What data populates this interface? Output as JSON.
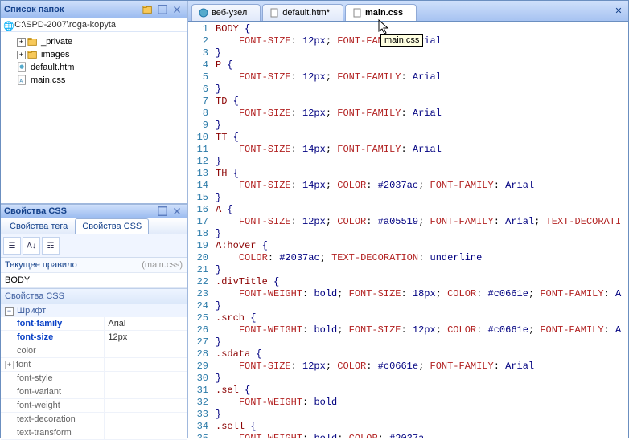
{
  "folder_panel": {
    "title": "Список папок",
    "address": "C:\\SPD-2007\\roga-kopyta",
    "items": [
      {
        "label": "_private",
        "type": "folder",
        "expand": "plus"
      },
      {
        "label": "images",
        "type": "folder",
        "expand": "plus"
      },
      {
        "label": "default.htm",
        "type": "file-htm"
      },
      {
        "label": "main.css",
        "type": "file-css"
      }
    ]
  },
  "css_panel": {
    "title": "Свойства CSS",
    "tabs": {
      "tag": "Свойства тега",
      "css": "Свойства CSS"
    },
    "rule_label": "Текущее правило",
    "rule_file": "(main.css)",
    "selector": "BODY",
    "section": "Свойства CSS",
    "group": "Шрифт",
    "props": [
      {
        "name": "font-family",
        "value": "Arial",
        "set": true,
        "exp": false
      },
      {
        "name": "font-size",
        "value": "12px",
        "set": true,
        "exp": false
      },
      {
        "name": "color",
        "value": "",
        "set": false,
        "exp": false
      },
      {
        "name": "font",
        "value": "",
        "set": false,
        "exp": true
      },
      {
        "name": "font-style",
        "value": "",
        "set": false,
        "exp": false
      },
      {
        "name": "font-variant",
        "value": "",
        "set": false,
        "exp": false
      },
      {
        "name": "font-weight",
        "value": "",
        "set": false,
        "exp": false
      },
      {
        "name": "text-decoration",
        "value": "",
        "set": false,
        "exp": false
      },
      {
        "name": "text-transform",
        "value": "",
        "set": false,
        "exp": false
      }
    ]
  },
  "editor": {
    "tabs": [
      {
        "label": "веб-узел",
        "icon": "web"
      },
      {
        "label": "default.htm*",
        "icon": "file"
      },
      {
        "label": "main.css",
        "icon": "file",
        "active": true
      }
    ],
    "tooltip": "main.css",
    "lines": [
      [
        {
          "t": "BODY ",
          "c": "c-sel"
        },
        {
          "t": "{",
          "c": "c-br"
        }
      ],
      [
        {
          "t": "    ",
          "c": ""
        },
        {
          "t": "FONT-SIZE",
          "c": "c-prop"
        },
        {
          "t": ": ",
          "c": "c-sep"
        },
        {
          "t": "12px",
          "c": "c-val"
        },
        {
          "t": "; ",
          "c": "c-sep"
        },
        {
          "t": "FONT-FAMILY",
          "c": "c-prop"
        },
        {
          "t": ": ",
          "c": "c-sep"
        },
        {
          "t": "Arial",
          "c": "c-val"
        }
      ],
      [
        {
          "t": "}",
          "c": "c-br"
        }
      ],
      [
        {
          "t": "P ",
          "c": "c-sel"
        },
        {
          "t": "{",
          "c": "c-br"
        }
      ],
      [
        {
          "t": "    ",
          "c": ""
        },
        {
          "t": "FONT-SIZE",
          "c": "c-prop"
        },
        {
          "t": ": ",
          "c": "c-sep"
        },
        {
          "t": "12px",
          "c": "c-val"
        },
        {
          "t": "; ",
          "c": "c-sep"
        },
        {
          "t": "FONT-FAMILY",
          "c": "c-prop"
        },
        {
          "t": ": ",
          "c": "c-sep"
        },
        {
          "t": "Arial",
          "c": "c-val"
        }
      ],
      [
        {
          "t": "}",
          "c": "c-br"
        }
      ],
      [
        {
          "t": "TD ",
          "c": "c-sel"
        },
        {
          "t": "{",
          "c": "c-br"
        }
      ],
      [
        {
          "t": "    ",
          "c": ""
        },
        {
          "t": "FONT-SIZE",
          "c": "c-prop"
        },
        {
          "t": ": ",
          "c": "c-sep"
        },
        {
          "t": "12px",
          "c": "c-val"
        },
        {
          "t": "; ",
          "c": "c-sep"
        },
        {
          "t": "FONT-FAMILY",
          "c": "c-prop"
        },
        {
          "t": ": ",
          "c": "c-sep"
        },
        {
          "t": "Arial",
          "c": "c-val"
        }
      ],
      [
        {
          "t": "}",
          "c": "c-br"
        }
      ],
      [
        {
          "t": "TT ",
          "c": "c-sel"
        },
        {
          "t": "{",
          "c": "c-br"
        }
      ],
      [
        {
          "t": "    ",
          "c": ""
        },
        {
          "t": "FONT-SIZE",
          "c": "c-prop"
        },
        {
          "t": ": ",
          "c": "c-sep"
        },
        {
          "t": "14px",
          "c": "c-val"
        },
        {
          "t": "; ",
          "c": "c-sep"
        },
        {
          "t": "FONT-FAMILY",
          "c": "c-prop"
        },
        {
          "t": ": ",
          "c": "c-sep"
        },
        {
          "t": "Arial",
          "c": "c-val"
        }
      ],
      [
        {
          "t": "}",
          "c": "c-br"
        }
      ],
      [
        {
          "t": "TH ",
          "c": "c-sel"
        },
        {
          "t": "{",
          "c": "c-br"
        }
      ],
      [
        {
          "t": "    ",
          "c": ""
        },
        {
          "t": "FONT-SIZE",
          "c": "c-prop"
        },
        {
          "t": ": ",
          "c": "c-sep"
        },
        {
          "t": "14px",
          "c": "c-val"
        },
        {
          "t": "; ",
          "c": "c-sep"
        },
        {
          "t": "COLOR",
          "c": "c-prop"
        },
        {
          "t": ": ",
          "c": "c-sep"
        },
        {
          "t": "#2037ac",
          "c": "c-val"
        },
        {
          "t": "; ",
          "c": "c-sep"
        },
        {
          "t": "FONT-FAMILY",
          "c": "c-prop"
        },
        {
          "t": ": ",
          "c": "c-sep"
        },
        {
          "t": "Arial",
          "c": "c-val"
        }
      ],
      [
        {
          "t": "}",
          "c": "c-br"
        }
      ],
      [
        {
          "t": "A ",
          "c": "c-sel"
        },
        {
          "t": "{",
          "c": "c-br"
        }
      ],
      [
        {
          "t": "    ",
          "c": ""
        },
        {
          "t": "FONT-SIZE",
          "c": "c-prop"
        },
        {
          "t": ": ",
          "c": "c-sep"
        },
        {
          "t": "12px",
          "c": "c-val"
        },
        {
          "t": "; ",
          "c": "c-sep"
        },
        {
          "t": "COLOR",
          "c": "c-prop"
        },
        {
          "t": ": ",
          "c": "c-sep"
        },
        {
          "t": "#a05519",
          "c": "c-val"
        },
        {
          "t": "; ",
          "c": "c-sep"
        },
        {
          "t": "FONT-FAMILY",
          "c": "c-prop"
        },
        {
          "t": ": ",
          "c": "c-sep"
        },
        {
          "t": "Arial",
          "c": "c-val"
        },
        {
          "t": "; ",
          "c": "c-sep"
        },
        {
          "t": "TEXT-DECORATI",
          "c": "c-prop"
        }
      ],
      [
        {
          "t": "}",
          "c": "c-br"
        }
      ],
      [
        {
          "t": "A:hover ",
          "c": "c-sel"
        },
        {
          "t": "{",
          "c": "c-br"
        }
      ],
      [
        {
          "t": "    ",
          "c": ""
        },
        {
          "t": "COLOR",
          "c": "c-prop"
        },
        {
          "t": ": ",
          "c": "c-sep"
        },
        {
          "t": "#2037ac",
          "c": "c-val"
        },
        {
          "t": "; ",
          "c": "c-sep"
        },
        {
          "t": "TEXT-DECORATION",
          "c": "c-prop"
        },
        {
          "t": ": ",
          "c": "c-sep"
        },
        {
          "t": "underline",
          "c": "c-val"
        }
      ],
      [
        {
          "t": "}",
          "c": "c-br"
        }
      ],
      [
        {
          "t": ".divTitle ",
          "c": "c-sel"
        },
        {
          "t": "{",
          "c": "c-br"
        }
      ],
      [
        {
          "t": "    ",
          "c": ""
        },
        {
          "t": "FONT-WEIGHT",
          "c": "c-prop"
        },
        {
          "t": ": ",
          "c": "c-sep"
        },
        {
          "t": "bold",
          "c": "c-val"
        },
        {
          "t": "; ",
          "c": "c-sep"
        },
        {
          "t": "FONT-SIZE",
          "c": "c-prop"
        },
        {
          "t": ": ",
          "c": "c-sep"
        },
        {
          "t": "18px",
          "c": "c-val"
        },
        {
          "t": "; ",
          "c": "c-sep"
        },
        {
          "t": "COLOR",
          "c": "c-prop"
        },
        {
          "t": ": ",
          "c": "c-sep"
        },
        {
          "t": "#c0661e",
          "c": "c-val"
        },
        {
          "t": "; ",
          "c": "c-sep"
        },
        {
          "t": "FONT-FAMILY",
          "c": "c-prop"
        },
        {
          "t": ": ",
          "c": "c-sep"
        },
        {
          "t": "A",
          "c": "c-val"
        }
      ],
      [
        {
          "t": "}",
          "c": "c-br"
        }
      ],
      [
        {
          "t": ".srch ",
          "c": "c-sel"
        },
        {
          "t": "{",
          "c": "c-br"
        }
      ],
      [
        {
          "t": "    ",
          "c": ""
        },
        {
          "t": "FONT-WEIGHT",
          "c": "c-prop"
        },
        {
          "t": ": ",
          "c": "c-sep"
        },
        {
          "t": "bold",
          "c": "c-val"
        },
        {
          "t": "; ",
          "c": "c-sep"
        },
        {
          "t": "FONT-SIZE",
          "c": "c-prop"
        },
        {
          "t": ": ",
          "c": "c-sep"
        },
        {
          "t": "12px",
          "c": "c-val"
        },
        {
          "t": "; ",
          "c": "c-sep"
        },
        {
          "t": "COLOR",
          "c": "c-prop"
        },
        {
          "t": ": ",
          "c": "c-sep"
        },
        {
          "t": "#c0661e",
          "c": "c-val"
        },
        {
          "t": "; ",
          "c": "c-sep"
        },
        {
          "t": "FONT-FAMILY",
          "c": "c-prop"
        },
        {
          "t": ": ",
          "c": "c-sep"
        },
        {
          "t": "A",
          "c": "c-val"
        }
      ],
      [
        {
          "t": "}",
          "c": "c-br"
        }
      ],
      [
        {
          "t": ".sdata ",
          "c": "c-sel"
        },
        {
          "t": "{",
          "c": "c-br"
        }
      ],
      [
        {
          "t": "    ",
          "c": ""
        },
        {
          "t": "FONT-SIZE",
          "c": "c-prop"
        },
        {
          "t": ": ",
          "c": "c-sep"
        },
        {
          "t": "12px",
          "c": "c-val"
        },
        {
          "t": "; ",
          "c": "c-sep"
        },
        {
          "t": "COLOR",
          "c": "c-prop"
        },
        {
          "t": ": ",
          "c": "c-sep"
        },
        {
          "t": "#c0661e",
          "c": "c-val"
        },
        {
          "t": "; ",
          "c": "c-sep"
        },
        {
          "t": "FONT-FAMILY",
          "c": "c-prop"
        },
        {
          "t": ": ",
          "c": "c-sep"
        },
        {
          "t": "Arial",
          "c": "c-val"
        }
      ],
      [
        {
          "t": "}",
          "c": "c-br"
        }
      ],
      [
        {
          "t": ".sel ",
          "c": "c-sel"
        },
        {
          "t": "{",
          "c": "c-br"
        }
      ],
      [
        {
          "t": "    ",
          "c": ""
        },
        {
          "t": "FONT-WEIGHT",
          "c": "c-prop"
        },
        {
          "t": ": ",
          "c": "c-sep"
        },
        {
          "t": "bold",
          "c": "c-val"
        }
      ],
      [
        {
          "t": "}",
          "c": "c-br"
        }
      ],
      [
        {
          "t": ".sell ",
          "c": "c-sel"
        },
        {
          "t": "{",
          "c": "c-br"
        }
      ],
      [
        {
          "t": "    ",
          "c": ""
        },
        {
          "t": "FONT-WEIGHT",
          "c": "c-prop"
        },
        {
          "t": ": ",
          "c": "c-sep"
        },
        {
          "t": "bold",
          "c": "c-val"
        },
        {
          "t": "; ",
          "c": "c-sep"
        },
        {
          "t": "COLOR",
          "c": "c-prop"
        },
        {
          "t": ": ",
          "c": "c-sep"
        },
        {
          "t": "#2037a",
          "c": "c-val"
        }
      ]
    ]
  }
}
